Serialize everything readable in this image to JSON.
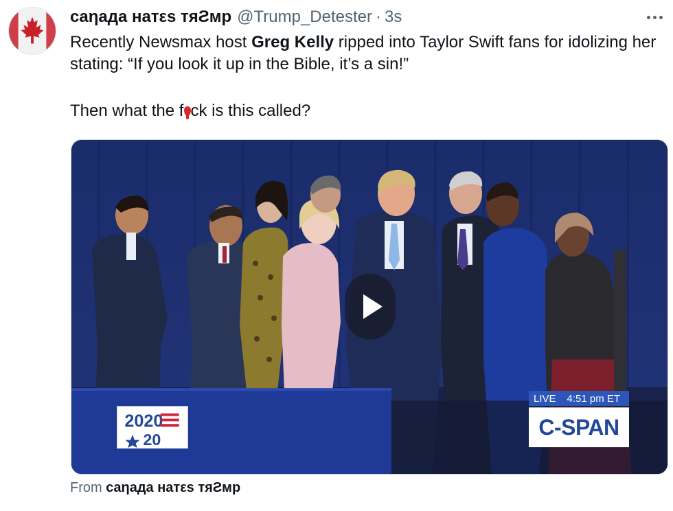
{
  "tweet": {
    "display_name": "caηaдa нaтεs тяƧмp",
    "handle": "@Trump_Detester",
    "separator": "·",
    "time_ago": "3s",
    "more_icon": "more-horizontal-icon",
    "avatar_icon": "canada-flag-avatar",
    "body": {
      "line1_pre": "Recently Newsmax host ",
      "line1_bold": "Greg Kelly",
      "line1_post": " ripped into Taylor Swift fans for idolizing her stating: “If you look it up in the Bible, it’s a sin!”",
      "line2_pre": "Then what the f",
      "line2_post": "ck is this called?"
    },
    "media": {
      "type": "video",
      "play_icon": "play-icon",
      "logo_2020": "2020",
      "live_label": "LIVE",
      "live_time": "4:51 pm ET",
      "network": "C-SPAN"
    },
    "footer": {
      "from_label": "From",
      "source_name": "caηaдa нaтεs тяƧмp"
    }
  },
  "colors": {
    "text_primary": "#0f1419",
    "text_secondary": "#536471",
    "cspan_blue": "#23489a",
    "live_bar": "#2c56b8",
    "drop_red": "#e0242a"
  }
}
